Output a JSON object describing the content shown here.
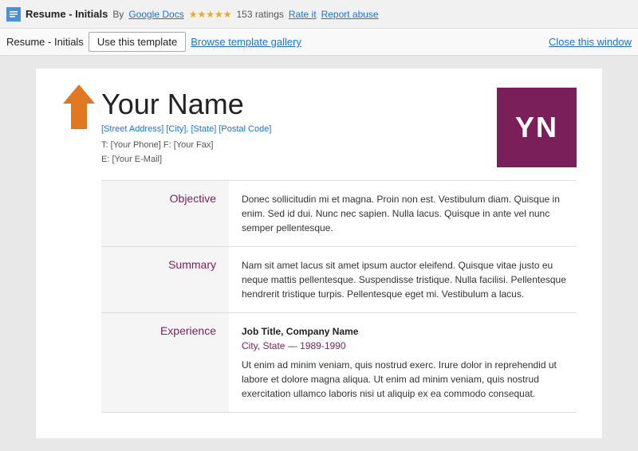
{
  "topbar": {
    "doc_title": "Resume - Initials",
    "by_label": "By",
    "google_docs": "Google Docs",
    "stars": "★★★★★",
    "ratings_count": "153 ratings",
    "rate_it": "Rate it",
    "report_abuse": "Report abuse"
  },
  "secondbar": {
    "subtitle": "Resume - Initials",
    "use_template_label": "Use this template",
    "browse_label": "Browse template gallery",
    "close_label": "Close this window"
  },
  "resume": {
    "name": "Your Name",
    "address": "[Street Address] [City], [State] [Postal Code]",
    "phone_line": "T: [Your Phone]  F: [Your Fax]",
    "email_line": "E: [Your E-Mail]",
    "initials": "YN",
    "sections": [
      {
        "label": "Objective",
        "content": "Donec sollicitudin mi et magna. Proin non est. Vestibulum diam. Quisque in enim. Sed id dui. Nunc nec sapien. Nulla lacus. Quisque in ante vel nunc semper pellentesque."
      },
      {
        "label": "Summary",
        "content": "Nam sit amet lacus sit amet ipsum auctor eleifend. Quisque vitae justo eu neque mattis pellentesque. Suspendisse tristique. Nulla facilisi. Pellentesque hendrerit tristique turpis. Pellentesque eget mi. Vestibulum a lacus."
      },
      {
        "label": "Experience",
        "job_title": "Job Title, Company Name",
        "city_state": "City, State — 1989-1990",
        "content": "Ut enim ad minim veniam, quis nostrud exerc. Irure dolor in reprehendid ut labore et dolore magna aliqua. Ut enim ad minim veniam, quis nostrud exercitation ullamco laboris nisi ut aliquip ex ea commodo consequat."
      }
    ]
  },
  "colors": {
    "accent": "#7b1f5a",
    "link": "#1a73e8",
    "arrow": "#e07820"
  }
}
